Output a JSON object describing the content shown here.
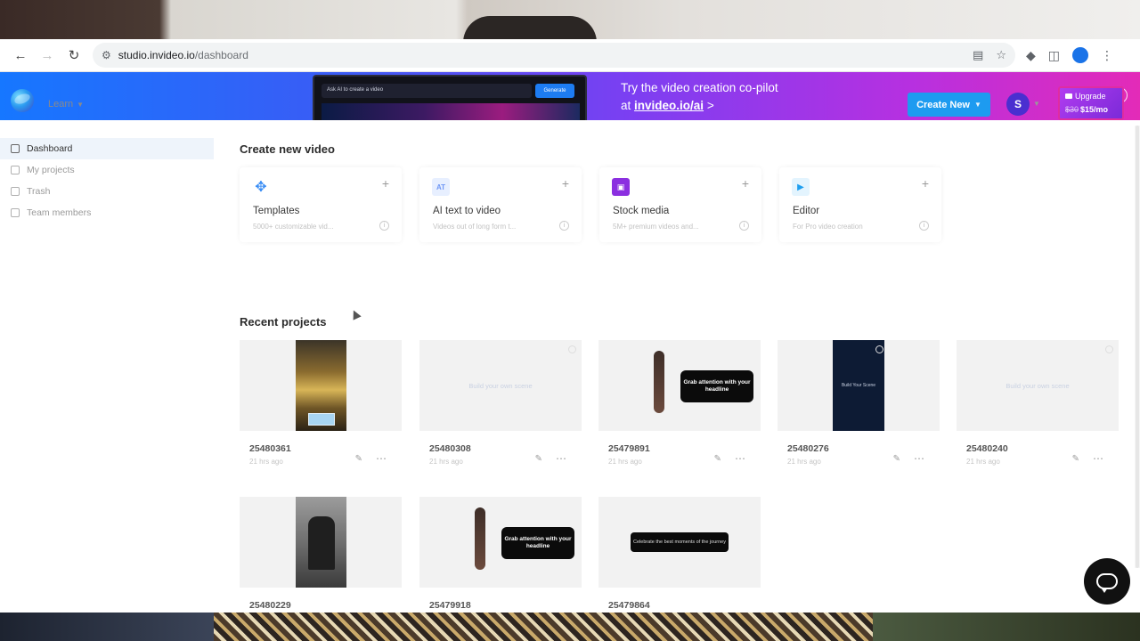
{
  "browser": {
    "url_host": "studio.invideo.io",
    "url_path": "/dashboard",
    "profile_initial": ""
  },
  "banner": {
    "preview_prompt": "Ask AI to create a video",
    "preview_button": "Generate",
    "line1": "Try the video creation co-pilot",
    "line2_prefix": "at",
    "line2_link": "invideo.io/ai",
    "line2_suffix": ">"
  },
  "header": {
    "learn_label": "Learn",
    "create_new_label": "Create New",
    "avatar_initial": "S",
    "upgrade_label": "Upgrade",
    "upgrade_old_price": "$30",
    "upgrade_price": "$15/mo"
  },
  "sidebar": {
    "items": [
      {
        "label": "Dashboard",
        "active": true
      },
      {
        "label": "My projects",
        "active": false
      },
      {
        "label": "Trash",
        "active": false
      },
      {
        "label": "Team members",
        "active": false
      }
    ]
  },
  "create": {
    "title": "Create new video",
    "cards": [
      {
        "title": "Templates",
        "desc": "5000+ customizable vid...",
        "icon": "templates-icon",
        "color": "#3b8ef5"
      },
      {
        "title": "AI text to video",
        "desc": "Videos out of long form t...",
        "icon": "ai-text-icon",
        "color": "#7aa7ff"
      },
      {
        "title": "Stock media",
        "desc": "5M+ premium videos and...",
        "icon": "stock-media-icon",
        "color": "#8b2fe0"
      },
      {
        "title": "Editor",
        "desc": "For Pro video creation",
        "icon": "editor-icon",
        "color": "#1e9ff0"
      }
    ]
  },
  "recent": {
    "title": "Recent projects",
    "projects": [
      {
        "id": "25480361",
        "date": "21 hrs ago",
        "kind": "city"
      },
      {
        "id": "25480308",
        "date": "21 hrs ago",
        "kind": "dark",
        "scene_text": "Build your own scene"
      },
      {
        "id": "25479891",
        "date": "21 hrs ago",
        "kind": "yoga",
        "scene_text": "Grab attention with your headline"
      },
      {
        "id": "25480276",
        "date": "21 hrs ago",
        "kind": "dark-portrait",
        "scene_text": "Build Your Scene"
      },
      {
        "id": "25480240",
        "date": "21 hrs ago",
        "kind": "dark",
        "scene_text": "Build your own scene"
      },
      {
        "id": "25480229",
        "date": "",
        "kind": "statue"
      },
      {
        "id": "25479918",
        "date": "",
        "kind": "yoga",
        "scene_text": "Grab attention with your headline"
      },
      {
        "id": "25479864",
        "date": "",
        "kind": "face",
        "scene_text": "Celebrate the best moments of the journey"
      }
    ]
  },
  "colors": {
    "primary": "#1d9bf0",
    "avatar": "#4a2fd0",
    "upgrade": "#b13cf0"
  }
}
